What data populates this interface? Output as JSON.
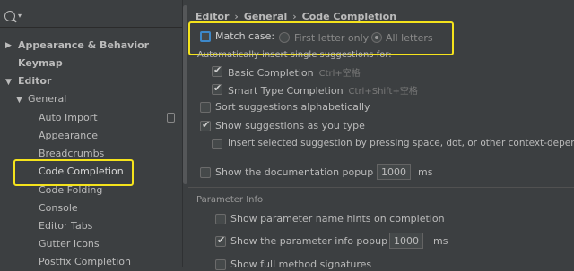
{
  "search": {
    "value": ""
  },
  "tree": {
    "appearance_behavior": "Appearance & Behavior",
    "keymap": "Keymap",
    "editor": "Editor",
    "general": "General",
    "auto_import": "Auto Import",
    "appearance": "Appearance",
    "breadcrumbs": "Breadcrumbs",
    "code_completion": "Code Completion",
    "code_folding": "Code Folding",
    "console": "Console",
    "editor_tabs": "Editor Tabs",
    "gutter_icons": "Gutter Icons",
    "postfix_completion": "Postfix Completion"
  },
  "breadcrumb": {
    "editor": "Editor",
    "general": "General",
    "code_completion": "Code Completion",
    "separator": "›"
  },
  "match_case": {
    "label": "Match case:",
    "checked": false,
    "option_first_letter": "First letter only",
    "option_all_letters": "All letters"
  },
  "auto_insert": {
    "title": "Automatically insert single suggestions for:",
    "basic": "Basic Completion",
    "basic_shortcut": "Ctrl+空格",
    "smart": "Smart Type Completion",
    "smart_shortcut": "Ctrl+Shift+空格"
  },
  "sort_alpha": "Sort suggestions alphabetically",
  "show_as_type": "Show suggestions as you type",
  "insert_selected": "Insert selected suggestion by pressing space, dot, or other context-dependent",
  "doc_popup": {
    "label": "Show the documentation popup in",
    "value": "1000",
    "unit": "ms"
  },
  "param_info": {
    "title": "Parameter Info",
    "name_hints": "Show parameter name hints on completion",
    "info_popup": "Show the parameter info popup in",
    "info_value": "1000",
    "info_unit": "ms",
    "full_signatures": "Show full method signatures"
  },
  "colors": {
    "highlight": "#f5e31c",
    "background": "#3c3f41",
    "text": "#bbbbbb"
  }
}
